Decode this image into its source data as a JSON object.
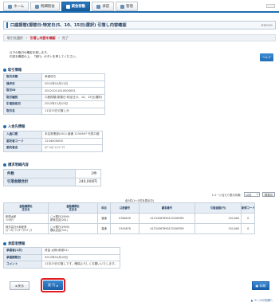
{
  "nav": {
    "tabs": [
      {
        "label": "ホーム",
        "active": false
      },
      {
        "label": "明細照会",
        "active": false
      },
      {
        "label": "資金移動",
        "active": true
      },
      {
        "label": "承認",
        "active": false
      },
      {
        "label": "管理",
        "active": false
      }
    ]
  },
  "title": {
    "text": "口座振替(振替日:特定日(5、10、15日)選択) 引落し内容確認",
    "code": "BTJE031"
  },
  "steps": {
    "step1": "取引先選択",
    "step2": "引落し内容を確認",
    "step3": "完了"
  },
  "intro": {
    "line1": "以下の取引の確定を致します。",
    "line2": "内容を確認の上、「実行」ボタンを押してください。"
  },
  "help_label": "ヘルプ",
  "transaction": {
    "header": "取引情報",
    "rows": [
      {
        "k": "取引状態",
        "v": "承認待ち"
      },
      {
        "k": "操作日",
        "v": "2012年10月11日"
      },
      {
        "k": "取引ID",
        "v": "20121011410000001"
      },
      {
        "k": "取引種別",
        "v": "口座振替(振替日:特定日(5、10、15日)選択)"
      },
      {
        "k": "引落指定日",
        "v": "2012年11月15日"
      },
      {
        "k": "取引名",
        "v": "11月15日引落し分"
      }
    ]
  },
  "payee": {
    "header": "入金先情報",
    "rows": [
      {
        "k": "入金口座",
        "v": "本店営業部(001) 普通 1234567 代表口座"
      },
      {
        "k": "委託者コード",
        "v": "1234000000"
      },
      {
        "k": "委託者名",
        "v": "ｶﾌﾞｼｷｶﾞｲｼｬﾃﾞｲﾜ"
      }
    ]
  },
  "summary": {
    "header": "請求明細内容",
    "rows": [
      {
        "k": "件数",
        "v": "2件"
      },
      {
        "k": "引落金額合計",
        "v": "240,000円"
      }
    ]
  },
  "pager": {
    "label": "1ページ当たり表示件数:",
    "value": "10件",
    "button": "再表示"
  },
  "page_count": "全2件(1～2件を表示中)",
  "detail": {
    "headers": [
      [
        "金融機関名",
        "支店名"
      ],
      [
        "金融機関名",
        "支店名"
      ],
      [
        "科目"
      ],
      [
        "口座番号"
      ],
      [
        "顧客番号"
      ],
      [
        "引落金額(円)"
      ],
      [
        "新規コード"
      ]
    ],
    "rows": [
      {
        "name": "新規太郎",
        "kana": "ｼﾝｷﾀﾛｳ",
        "bank": "◯×銀行(2999)",
        "branch": "新宿支店(001)",
        "type": "普通",
        "acct": "0766459",
        "cust": "A12345678901234567B9",
        "amount": "120,000",
        "code": "0"
      },
      {
        "name": "株式会社大和産業",
        "kana": "ｶﾌﾞｼｷｶﾞｲｼｬﾀﾞｲﾜｻﾝｷﾞｮｳ",
        "bank": "◯×銀行(2999)",
        "branch": "横浜支店(321)",
        "type": "普通",
        "acct": "2345678",
        "cust": "A12345678901234567B9",
        "amount": "120,000",
        "code": "0"
      }
    ]
  },
  "approval": {
    "header": "承認者情報",
    "rows": [
      {
        "k": "承認者(1次)",
        "v": "資金 太郎(承認01)"
      },
      {
        "k": "承認期限日",
        "v": "2012年10月16日"
      },
      {
        "k": "コメント",
        "v": "11月15日引落しです。確認よろしくお願いいたします。"
      }
    ]
  },
  "buttons": {
    "back": "戻る",
    "execute": "実 行",
    "print": "印刷"
  },
  "page_top": "ページの先頭へ"
}
